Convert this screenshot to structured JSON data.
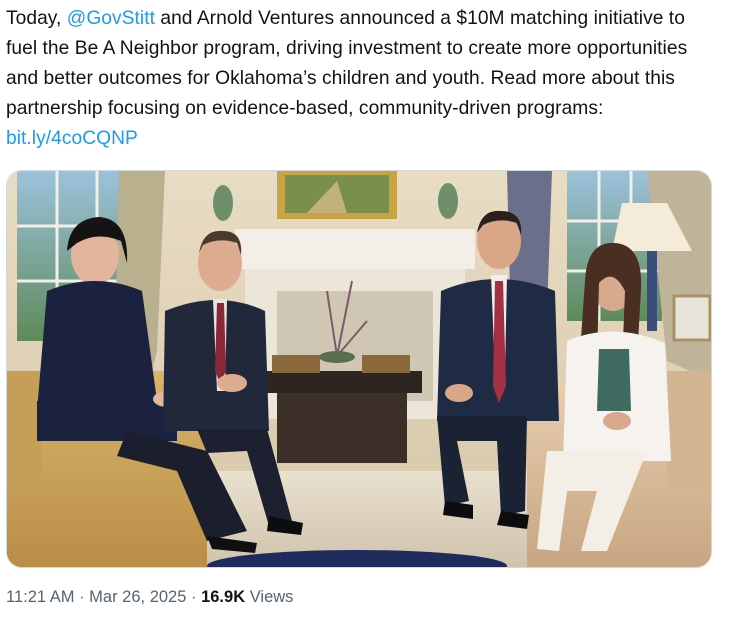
{
  "tweet": {
    "text_before_mention": "Today, ",
    "mention": "@GovStitt",
    "text_after_mention": " and Arnold Ventures announced a $10M matching initiative to fuel the Be A Neighbor program, driving investment to create more opportunities and better outcomes for Oklahoma’s children and youth. Read more about this partnership focusing on evidence-based, community-driven programs: ",
    "link": "bit.ly/4coCQNP"
  },
  "meta": {
    "time": "11:21 AM",
    "separator": " · ",
    "date": "Mar 26, 2025",
    "views_count": "16.9K",
    "views_label": " Views"
  },
  "colors": {
    "link": "#1d9bf0",
    "text": "#0f1419",
    "muted": "#536471"
  }
}
